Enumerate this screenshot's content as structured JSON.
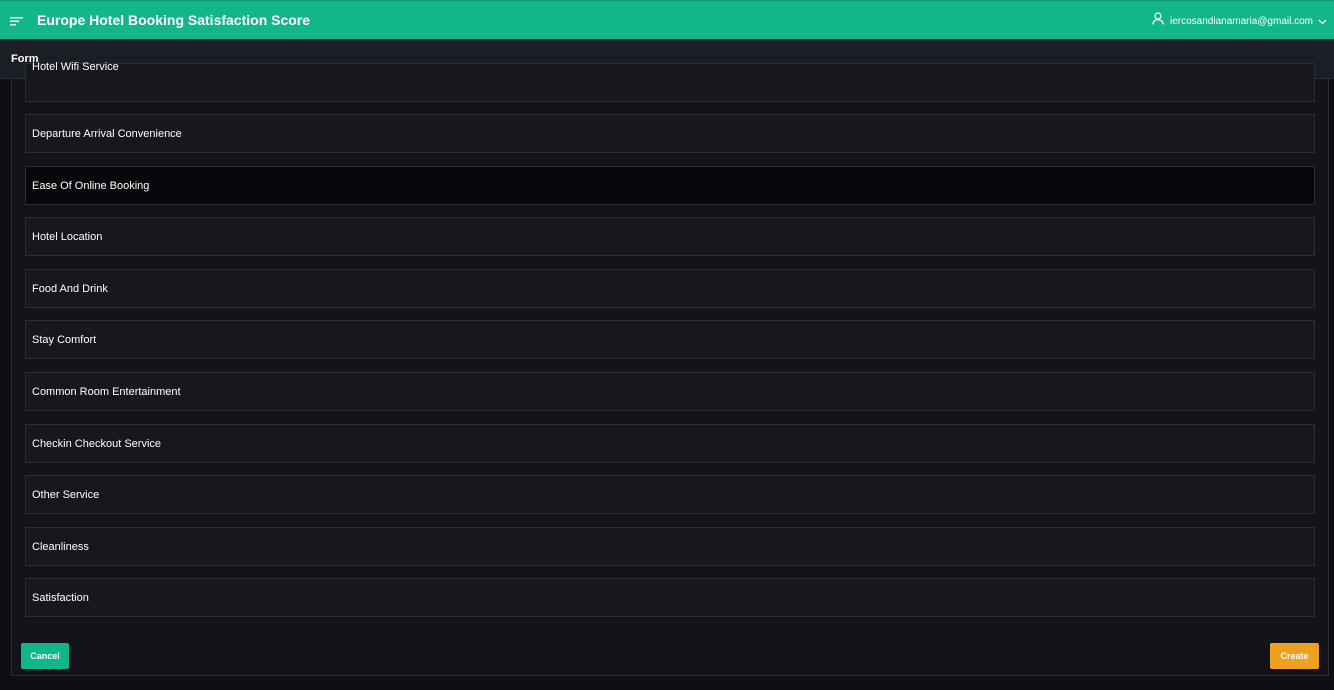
{
  "header": {
    "title": "Europe Hotel Booking Satisfaction Score",
    "user_email": "iercosandianamaria@gmail.com",
    "menu_icon": "menu-icon",
    "user_icon": "user-icon",
    "dropdown_icon": "chevron-down-icon"
  },
  "subheader": {
    "title": "Form"
  },
  "form": {
    "fields": [
      "Hotel Wifi Service",
      "Departure Arrival Convenience",
      "Ease Of Online Booking",
      "Hotel Location",
      "Food And Drink",
      "Stay Comfort",
      "Common Room Entertainment",
      "Checkin Checkout Service",
      "Other Service",
      "Cleanliness",
      "Satisfaction"
    ],
    "cancel_label": "Cancel",
    "create_label": "Create"
  },
  "colors": {
    "accent": "#12b68a",
    "create": "#f0a020",
    "background": "#0d0f13"
  }
}
